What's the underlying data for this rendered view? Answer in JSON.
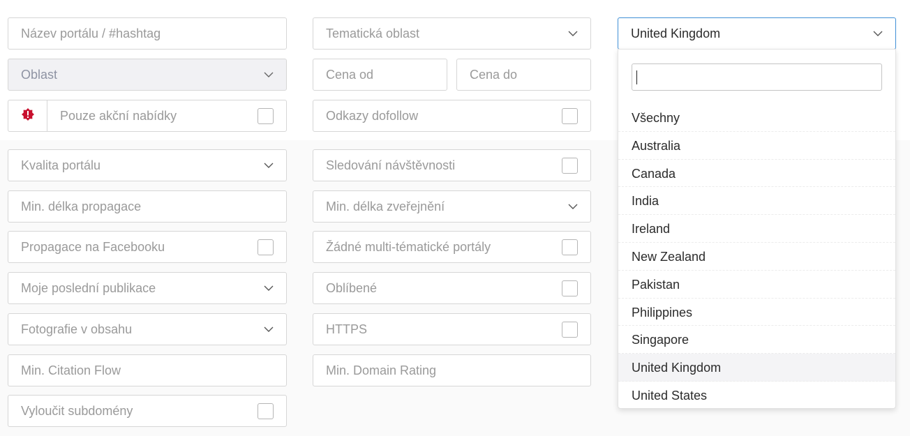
{
  "filters": {
    "portal_name_placeholder": "Název portálu / #hashtag",
    "topic_area": "Tematická oblast",
    "country_selected": "United Kingdom",
    "region": "Oblast",
    "price_from_placeholder": "Cena od",
    "price_to_placeholder": "Cena do",
    "only_promo": "Pouze akční nabídky",
    "dofollow_links": "Odkazy dofollow",
    "portal_quality": "Kvalita portálu",
    "traffic_tracking": "Sledování návštěvnosti",
    "min_promo_length_placeholder": "Min. délka propagace",
    "min_publish_length": "Min. délka zveřejnění",
    "facebook_promo": "Propagace na Facebooku",
    "no_multi_topic": "Žádné multi-tématické portály",
    "my_last_publications": "Moje poslední publikace",
    "favorites": "Oblíbené",
    "photos_in_content": "Fotografie v obsahu",
    "https": "HTTPS",
    "min_citation_flow_placeholder": "Min. Citation Flow",
    "min_domain_rating_placeholder": "Min. Domain Rating",
    "exclude_subdomains": "Vyloučit subdomény"
  },
  "dropdown": {
    "search_value": "",
    "options": [
      "Všechny",
      "Australia",
      "Canada",
      "India",
      "Ireland",
      "New Zealand",
      "Pakistan",
      "Philippines",
      "Singapore",
      "United Kingdom",
      "United States"
    ],
    "selected": "United Kingdom"
  },
  "colors": {
    "focus_border": "#3f8fd6",
    "alert_icon": "#c8102e",
    "placeholder": "#9a9a9a"
  }
}
